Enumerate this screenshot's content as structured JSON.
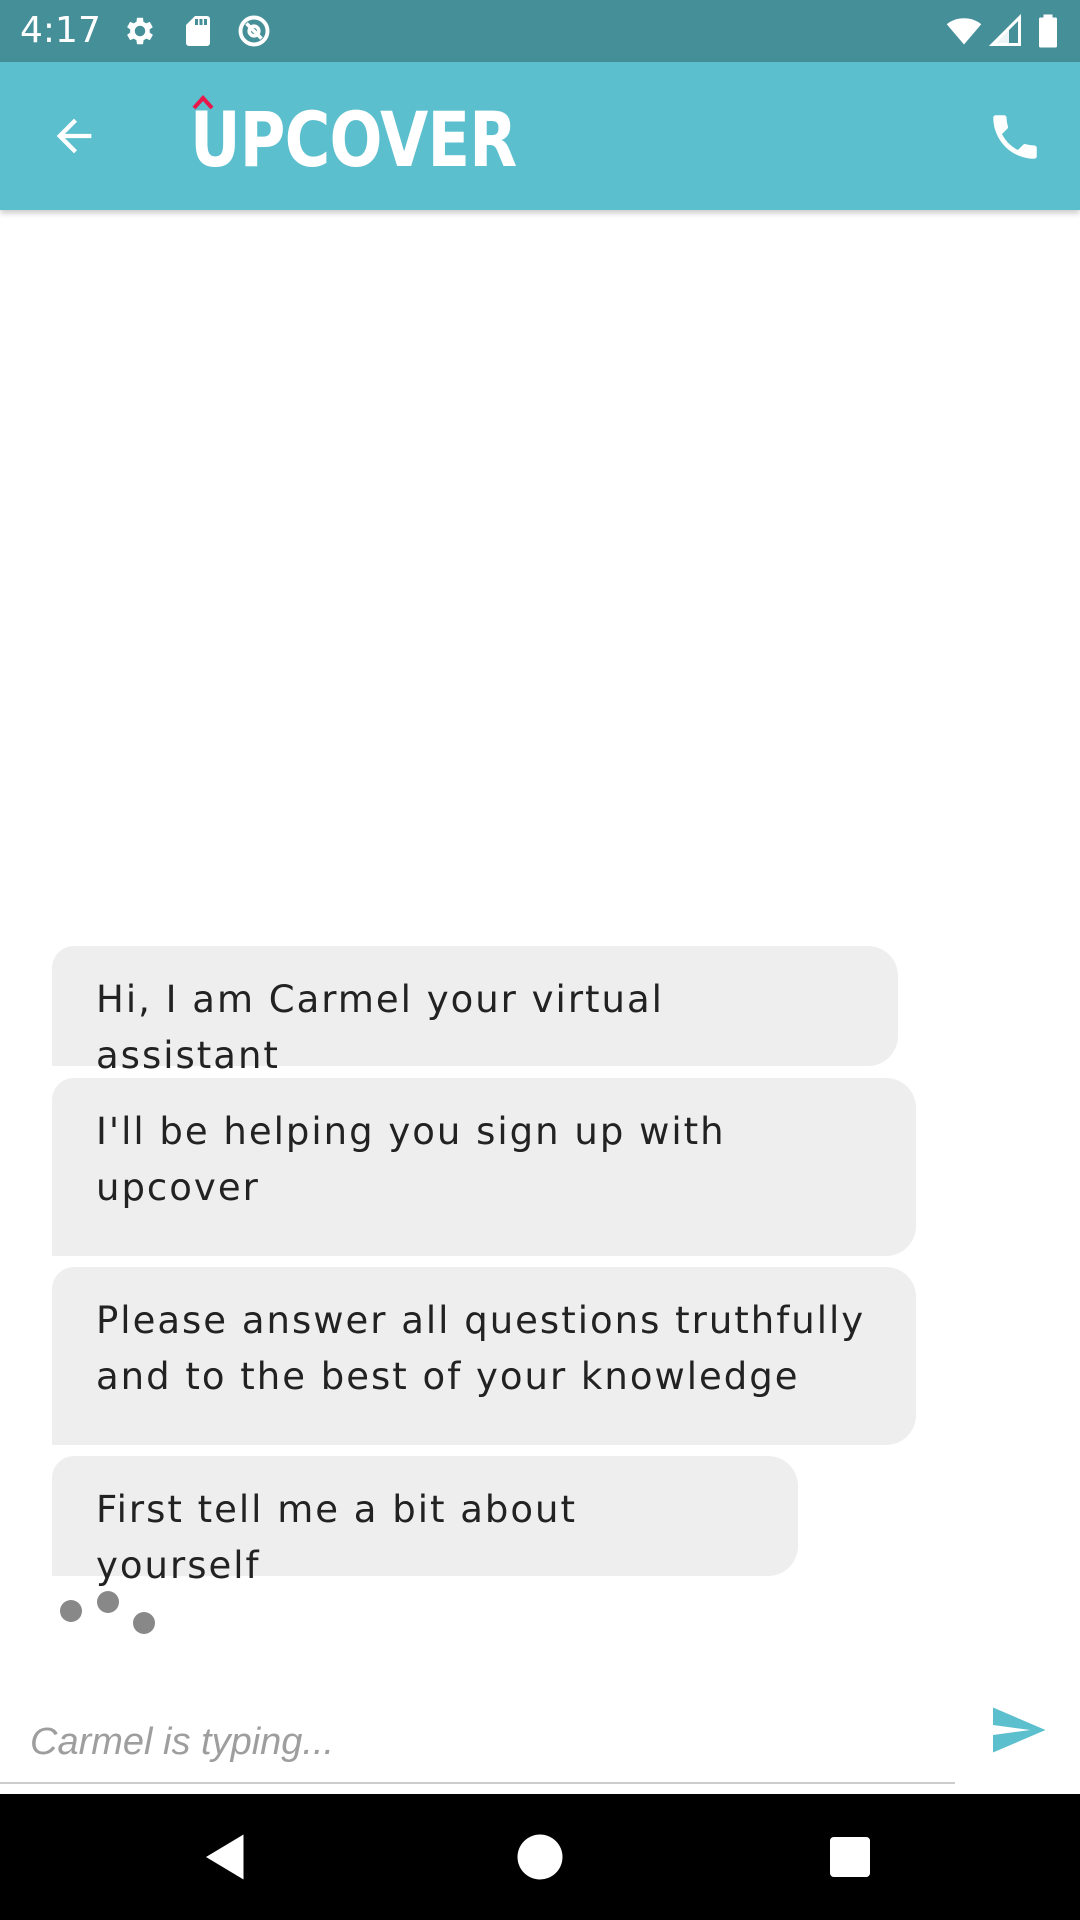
{
  "status_bar": {
    "time": "4:17",
    "left_icons": [
      "gear-icon",
      "sd-card-icon",
      "at-sign-icon"
    ],
    "right_icons": [
      "wifi-icon",
      "cell-signal-icon",
      "battery-icon"
    ]
  },
  "app_bar": {
    "logo_text": "UPCOVER",
    "back_icon": "arrow-left-icon",
    "call_icon": "phone-icon",
    "colors": {
      "bar": "#5bbfcd",
      "logo_accent": "#e8194a"
    }
  },
  "chat": {
    "messages": [
      {
        "sender": "bot",
        "text": "Hi, I am Carmel your virtual assistant"
      },
      {
        "sender": "bot",
        "text": "I'll be helping you sign up with upcover"
      },
      {
        "sender": "bot",
        "text": "Please answer all questions truthfully and to the best of your knowledge"
      },
      {
        "sender": "bot",
        "text": "First tell me a bit about yourself"
      }
    ],
    "typing_indicator": true
  },
  "composer": {
    "placeholder": "Carmel is typing...",
    "value": "",
    "send_icon": "send-icon"
  },
  "nav_bar": {
    "icons": [
      "back-triangle-icon",
      "home-circle-icon",
      "recents-square-icon"
    ]
  }
}
